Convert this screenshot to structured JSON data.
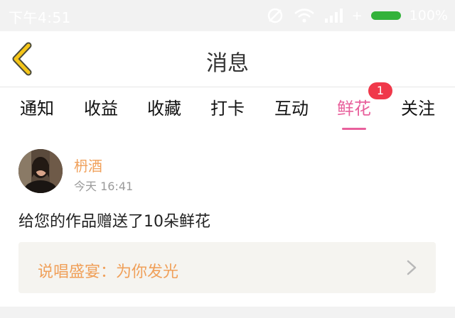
{
  "status_bar": {
    "time": "下午4:51",
    "battery_percent": "100%",
    "battery_color": "#33b23a"
  },
  "header": {
    "title": "消息",
    "back_icon": "chevron-left-icon",
    "back_icon_color": "#f5c518"
  },
  "tabs": [
    {
      "label": "通知",
      "active": false
    },
    {
      "label": "收益",
      "active": false
    },
    {
      "label": "收藏",
      "active": false
    },
    {
      "label": "打卡",
      "active": false
    },
    {
      "label": "互动",
      "active": false
    },
    {
      "label": "鲜花",
      "active": true,
      "badge": "1"
    },
    {
      "label": "关注",
      "active": false
    }
  ],
  "accent_color": "#e8609c",
  "message": {
    "sender": "枬酒",
    "time": "今天 16:41",
    "body": "给您的作品赠送了10朵鲜花",
    "work_title": "说唱盛宴：为你发光",
    "work_icon": "chevron-right-icon"
  }
}
